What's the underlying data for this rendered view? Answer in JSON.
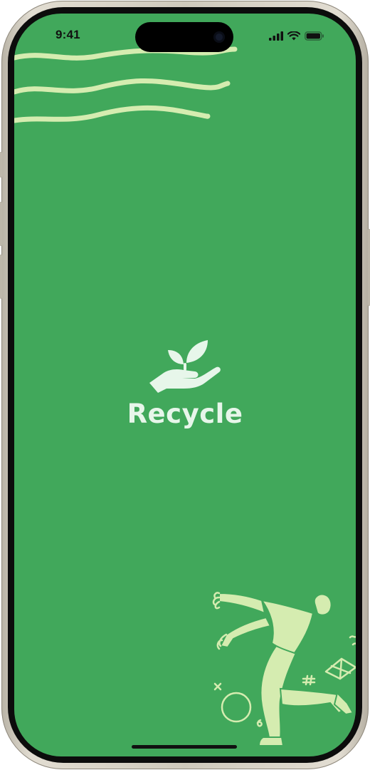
{
  "status_bar": {
    "time": "9:41",
    "icons": [
      "signal-icon",
      "wifi-icon",
      "battery-icon"
    ]
  },
  "splash": {
    "title": "Recycle",
    "logo_icon": "hand-sprout-icon"
  },
  "decorations": [
    "wavy-lines",
    "dancing-person-illustration"
  ],
  "colors": {
    "background": "#41a85b",
    "accent": "#d5ecb0",
    "logo": "#e7f6ea"
  }
}
